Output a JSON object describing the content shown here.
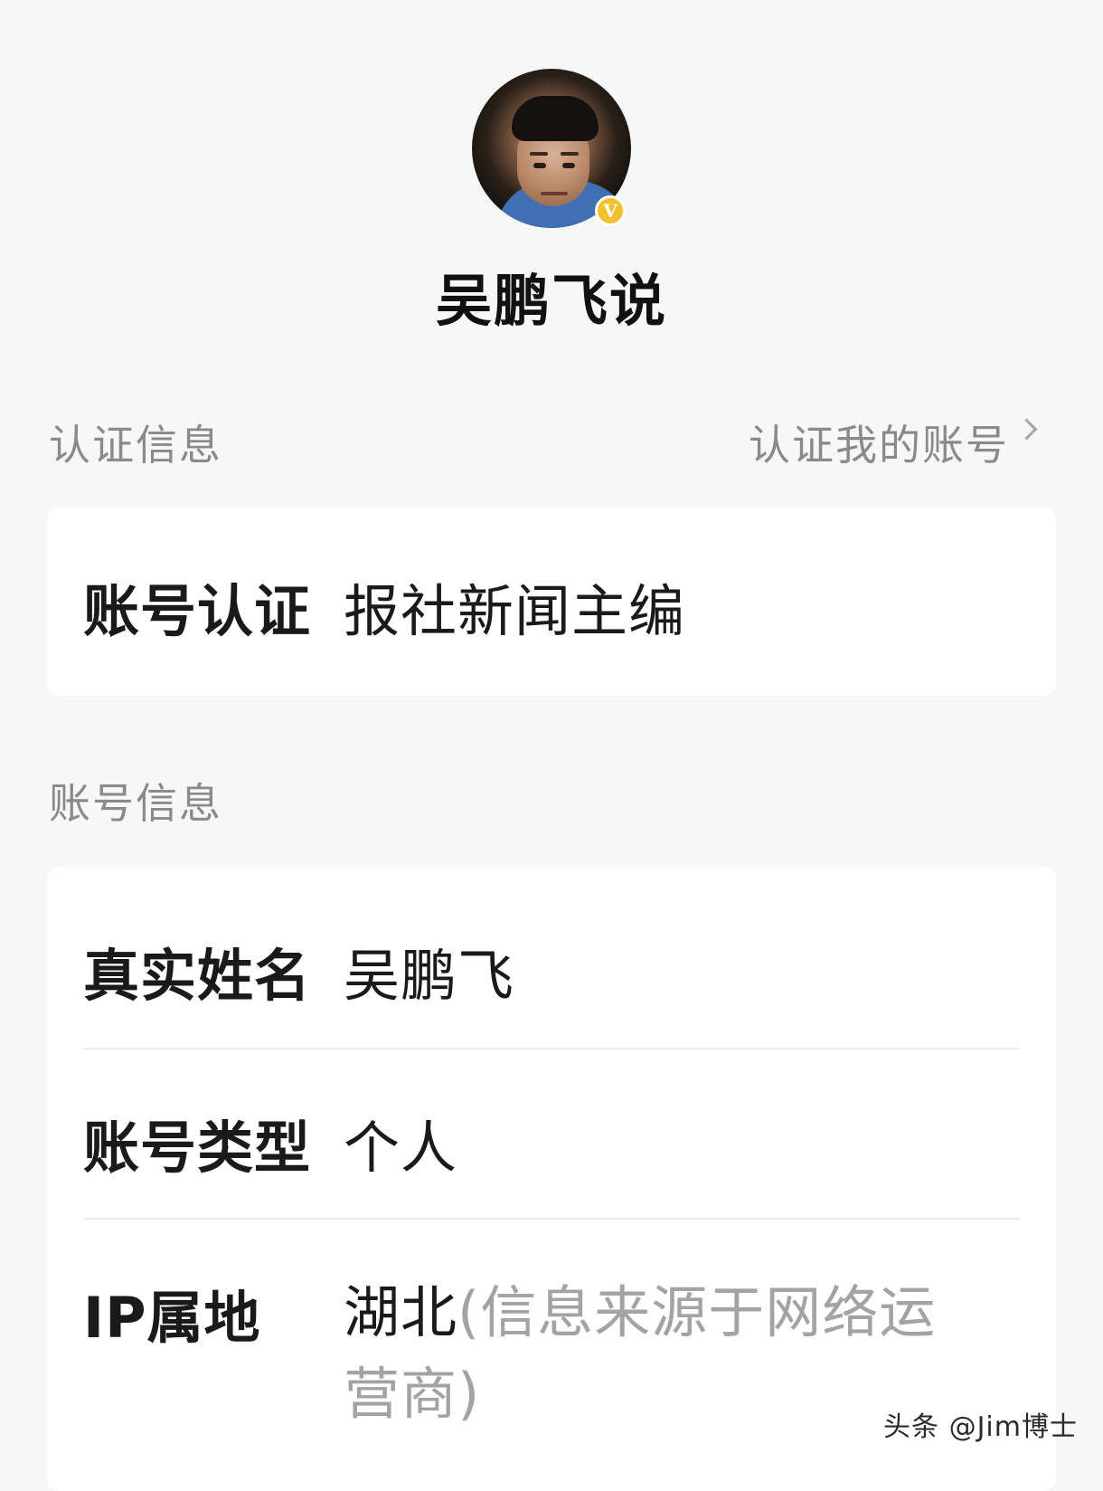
{
  "profile": {
    "name": "吴鹏飞说",
    "verified_badge": "V"
  },
  "certification": {
    "section_title": "认证信息",
    "link_label": "认证我的账号",
    "row": {
      "label": "账号认证",
      "value": "报社新闻主编"
    }
  },
  "account": {
    "section_title": "账号信息",
    "rows": [
      {
        "label": "真实姓名",
        "value": "吴鹏飞"
      },
      {
        "label": "账号类型",
        "value": "个人"
      }
    ],
    "ip": {
      "label": "IP属地",
      "region": "湖北",
      "note": "(信息来源于网络运营商)"
    }
  },
  "watermark": "头条 @Jim博士",
  "icons": {
    "verified": "verified-badge-icon",
    "chevron": "chevron-right-icon"
  },
  "colors": {
    "background": "#f7f7f7",
    "card": "#ffffff",
    "muted_text": "#8a8a8a",
    "badge": "#f2c12e"
  }
}
